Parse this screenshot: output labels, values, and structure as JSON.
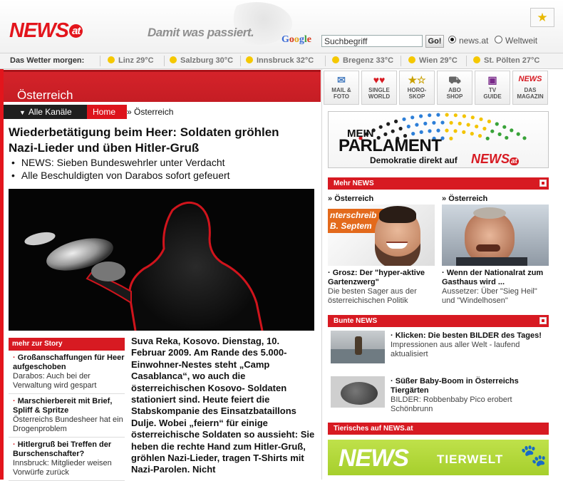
{
  "header": {
    "logo_text": "NEWS",
    "logo_badge": "at",
    "slogan": "Damit was passiert.",
    "search_engine": "Google",
    "search_value": "Suchbegriff",
    "go_label": "Go!",
    "radio_news": "news.at",
    "radio_web": "Weltweit",
    "bookmark_icon": "star-icon"
  },
  "weather": {
    "label": "Das Wetter morgen:",
    "items": [
      {
        "city": "Linz 29°C"
      },
      {
        "city": "Salzburg 30°C"
      },
      {
        "city": "Innsbruck 32°C"
      },
      {
        "city": "Bregenz 33°C"
      },
      {
        "city": "Wien 29°C"
      },
      {
        "city": "St. Pölten 27°C"
      }
    ]
  },
  "section": {
    "title": "Österreich",
    "all_channels": "Alle Kanäle",
    "home": "Home",
    "crumb_arrow": "»",
    "crumb": "Österreich"
  },
  "article": {
    "headline": "Wiederbetätigung beim Heer: Soldaten gröhlen Nazi-Lieder und üben Hitler-Gruß",
    "bullets": [
      "NEWS: Sieben Bundeswehrler unter Verdacht",
      "Alle Beschuldigten von Darabos sofort gefeuert"
    ],
    "body": "Suva Reka, Kosovo. Dienstag, 10. Februar 2009. Am Rande des 5.000-Einwohner-Nestes steht „Camp Casablanca“, wo auch die österreichischen Kosovo- Soldaten stationiert sind. Heute feiert die Stabskompanie des Einsatzbataillons Dulje. Wobei „feiern“ für einige österreichische Soldaten so aussieht: Sie heben die rechte Hand zum Hitler-Gruß, gröhlen Nazi-Lieder, tragen T-Shirts mit Nazi-Parolen. Nicht"
  },
  "story": {
    "header": "mehr zur Story",
    "items": [
      {
        "title": "Großanschaffungen für Heer aufgeschoben",
        "text": "Darabos: Auch bei der Verwaltung wird gespart"
      },
      {
        "title": "Marschierbereit mit Brief, Spliff & Spritze",
        "text": "Österreichs Bundesheer hat ein Drogenproblem"
      },
      {
        "title": "Hitlergruß bei Treffen der Burschenschafter?",
        "text": "Innsbruck: Mitglieder weisen Vorwürfe zurück"
      }
    ]
  },
  "iconbar": [
    {
      "l1": "MAIL &",
      "l2": "FOTO",
      "icon": "mail-photo-icon",
      "glyph": "✉",
      "color": "#4a7fc1"
    },
    {
      "l1": "SINGLE",
      "l2": "WORLD",
      "icon": "hearts-icon",
      "glyph": "♥♥",
      "color": "#d71a22"
    },
    {
      "l1": "HORO-",
      "l2": "SKOP",
      "icon": "stars-icon",
      "glyph": "★☆",
      "color": "#c9a000"
    },
    {
      "l1": "ABO",
      "l2": "SHOP",
      "icon": "cart-icon",
      "glyph": "🛒",
      "color": "#666"
    },
    {
      "l1": "TV",
      "l2": "GUIDE",
      "icon": "tv-icon",
      "glyph": "▣",
      "color": "#7a2a8a"
    },
    {
      "l1": "DAS",
      "l2": "MAGAZIN",
      "icon": "news-magazine-icon",
      "glyph": "NEWS",
      "color": "#d71a22"
    }
  ],
  "parlament": {
    "line1": "MEIN",
    "line2": "PARLAMENT",
    "tagline": "Demokratie direkt auf",
    "brand": "NEWS",
    "brand_badge": "at",
    "colors": [
      "#d71a22",
      "#1f1f1f",
      "#2d7fd8",
      "#f3c400",
      "#39a339",
      "#777"
    ]
  },
  "mehr_news": {
    "header": "Mehr NEWS",
    "items": [
      {
        "section": "Österreich",
        "title": "Grosz: Der \"hyper-aktive Gartenzwerg\"",
        "text": "Die besten Sager aus der österreichischen Politik",
        "photo_text": "nterschreib\nB. Septem"
      },
      {
        "section": "Österreich",
        "title": "Wenn der Nationalrat zum Gasthaus wird ...",
        "text": "Aussetzer: Über \"Sieg Heil\" und \"Windelhosen\""
      }
    ]
  },
  "bunte_news": {
    "header": "Bunte NEWS",
    "items": [
      {
        "title": "Klicken: Die besten BILDER des Tages!",
        "text": "Impressionen aus aller Welt - laufend aktualisiert"
      },
      {
        "title": "Süßer Baby-Boom in Österreichs Tiergärten",
        "text": "BILDER: Robbenbaby Pico erobert Schönbrunn"
      }
    ]
  },
  "tierisches": {
    "header": "Tierisches auf NEWS.at",
    "banner_brand": "NEWS",
    "banner_sub": "TIERWELT"
  }
}
